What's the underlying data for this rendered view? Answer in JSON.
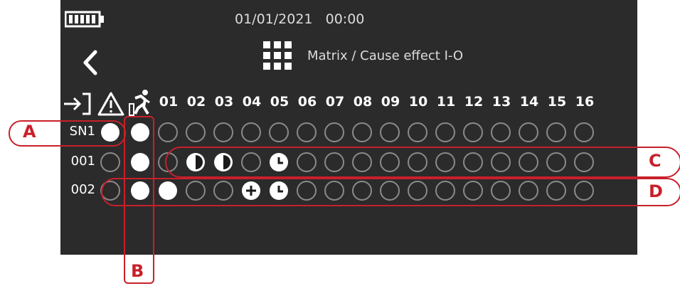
{
  "header": {
    "datetime": "01/01/2021   00:00",
    "title": "Matrix / Cause effect I-O"
  },
  "icons": {
    "battery": "battery-full-icon",
    "back": "chevron-left-icon",
    "matrix": "grid-icon",
    "input": "input-arrow-icon",
    "fault": "warning-triangle-icon",
    "evacuation": "running-person-icon"
  },
  "columns": [
    "01",
    "02",
    "03",
    "04",
    "05",
    "06",
    "07",
    "08",
    "09",
    "10",
    "11",
    "12",
    "13",
    "14",
    "15",
    "16"
  ],
  "rows": [
    {
      "label": "SN1",
      "states": {
        "fault": "full",
        "evac": "full",
        "cells": [
          "empty",
          "empty",
          "empty",
          "empty",
          "empty",
          "empty",
          "empty",
          "empty",
          "empty",
          "empty",
          "empty",
          "empty",
          "empty",
          "empty",
          "empty",
          "empty"
        ]
      }
    },
    {
      "label": "001",
      "states": {
        "fault": "empty",
        "evac": "full",
        "cells": [
          "empty",
          "half",
          "half",
          "empty",
          "clock",
          "empty",
          "empty",
          "empty",
          "empty",
          "empty",
          "empty",
          "empty",
          "empty",
          "empty",
          "empty",
          "empty"
        ]
      }
    },
    {
      "label": "002",
      "states": {
        "fault": "empty",
        "evac": "full",
        "cells": [
          "full",
          "empty",
          "empty",
          "plus",
          "clock",
          "empty",
          "empty",
          "empty",
          "empty",
          "empty",
          "empty",
          "empty",
          "empty",
          "empty",
          "empty",
          "empty"
        ]
      }
    }
  ],
  "callouts": [
    "A",
    "B",
    "C",
    "D"
  ],
  "colors": {
    "screen": "#2b2b2b",
    "callout": "#c8202a",
    "active": "#ffffff",
    "inactive": "#8a8a8a"
  }
}
